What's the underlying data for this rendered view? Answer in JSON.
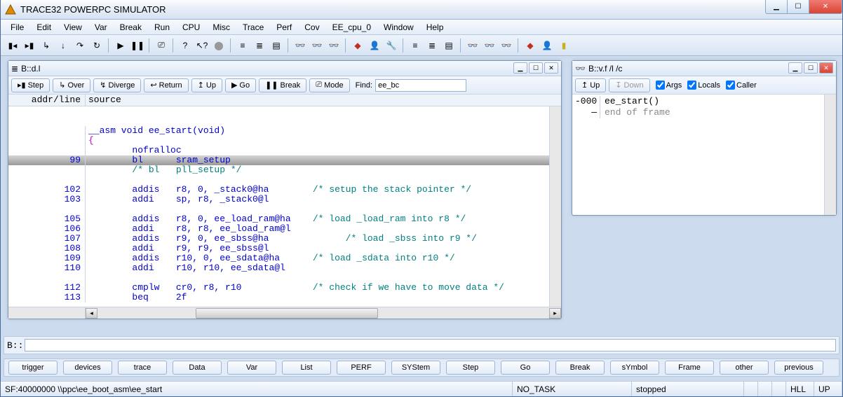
{
  "app": {
    "title": "TRACE32 POWERPC SIMULATOR"
  },
  "menu": [
    "File",
    "Edit",
    "View",
    "Var",
    "Break",
    "Run",
    "CPU",
    "Misc",
    "Trace",
    "Perf",
    "Cov",
    "EE_cpu_0",
    "Window",
    "Help"
  ],
  "sub1": {
    "title": "B::d.l",
    "buttons": {
      "step": "Step",
      "over": "Over",
      "diverge": "Diverge",
      "return": "Return",
      "up": "Up",
      "go": "Go",
      "break": "Break",
      "mode": "Mode"
    },
    "find_label": "Find:",
    "find_placeholder": "ee_bc",
    "head": {
      "addrline": "addr/line",
      "source": "source"
    },
    "lines": [
      {
        "ln": "",
        "src": "__asm void ee_start(void)",
        "kw": true,
        "hl": false
      },
      {
        "ln": "",
        "src": "{",
        "mag": true
      },
      {
        "ln": "",
        "src": "        nofralloc",
        "kw": true
      },
      {
        "ln": "99",
        "src": "        bl      sram_setup",
        "kw": true,
        "hl": true
      },
      {
        "ln": "",
        "src": "        /* bl   pll_setup */",
        "cm": true
      },
      {
        "ln": "",
        "src": ""
      },
      {
        "ln": "102",
        "src": "        addis   r8, 0, _stack0@ha        /* setup the stack pointer */",
        "mix": true
      },
      {
        "ln": "103",
        "src": "        addi    sp, r8, _stack0@l",
        "kw": true
      },
      {
        "ln": "",
        "src": ""
      },
      {
        "ln": "105",
        "src": "        addis   r8, 0, ee_load_ram@ha    /* load _load_ram into r8 */",
        "mix": true
      },
      {
        "ln": "106",
        "src": "        addi    r8, r8, ee_load_ram@l",
        "kw": true
      },
      {
        "ln": "107",
        "src": "        addis   r9, 0, ee_sbss@ha              /* load _sbss into r9 */",
        "mix": true
      },
      {
        "ln": "108",
        "src": "        addi    r9, r9, ee_sbss@l",
        "kw": true
      },
      {
        "ln": "109",
        "src": "        addis   r10, 0, ee_sdata@ha      /* load _sdata into r10 */",
        "mix": true
      },
      {
        "ln": "110",
        "src": "        addi    r10, r10, ee_sdata@l",
        "kw": true
      },
      {
        "ln": "",
        "src": ""
      },
      {
        "ln": "112",
        "src": "        cmplw   cr0, r8, r10             /* check if we have to move data */",
        "mix": true
      },
      {
        "ln": "113",
        "src": "        beq     2f",
        "kw": true
      }
    ]
  },
  "sub2": {
    "title": "B::v.f /l /c",
    "up": "Up",
    "down": "Down",
    "args": "Args",
    "locals": "Locals",
    "caller": "Caller",
    "rows": [
      {
        "ln": "-000",
        "txt": "ee_start()",
        "black": true
      },
      {
        "ln": "—",
        "txt": "end of frame",
        "grey": true
      }
    ]
  },
  "cmd": {
    "prompt": "B::"
  },
  "bottom": [
    "trigger",
    "devices",
    "trace",
    "Data",
    "Var",
    "List",
    "PERF",
    "SYStem",
    "Step",
    "Go",
    "Break",
    "sYmbol",
    "Frame",
    "other",
    "previous"
  ],
  "status": {
    "left": "SF:40000000  \\\\ppc\\ee_boot_asm\\ee_start",
    "task": "NO_TASK",
    "state": "stopped",
    "hll": "HLL",
    "up": "UP"
  }
}
